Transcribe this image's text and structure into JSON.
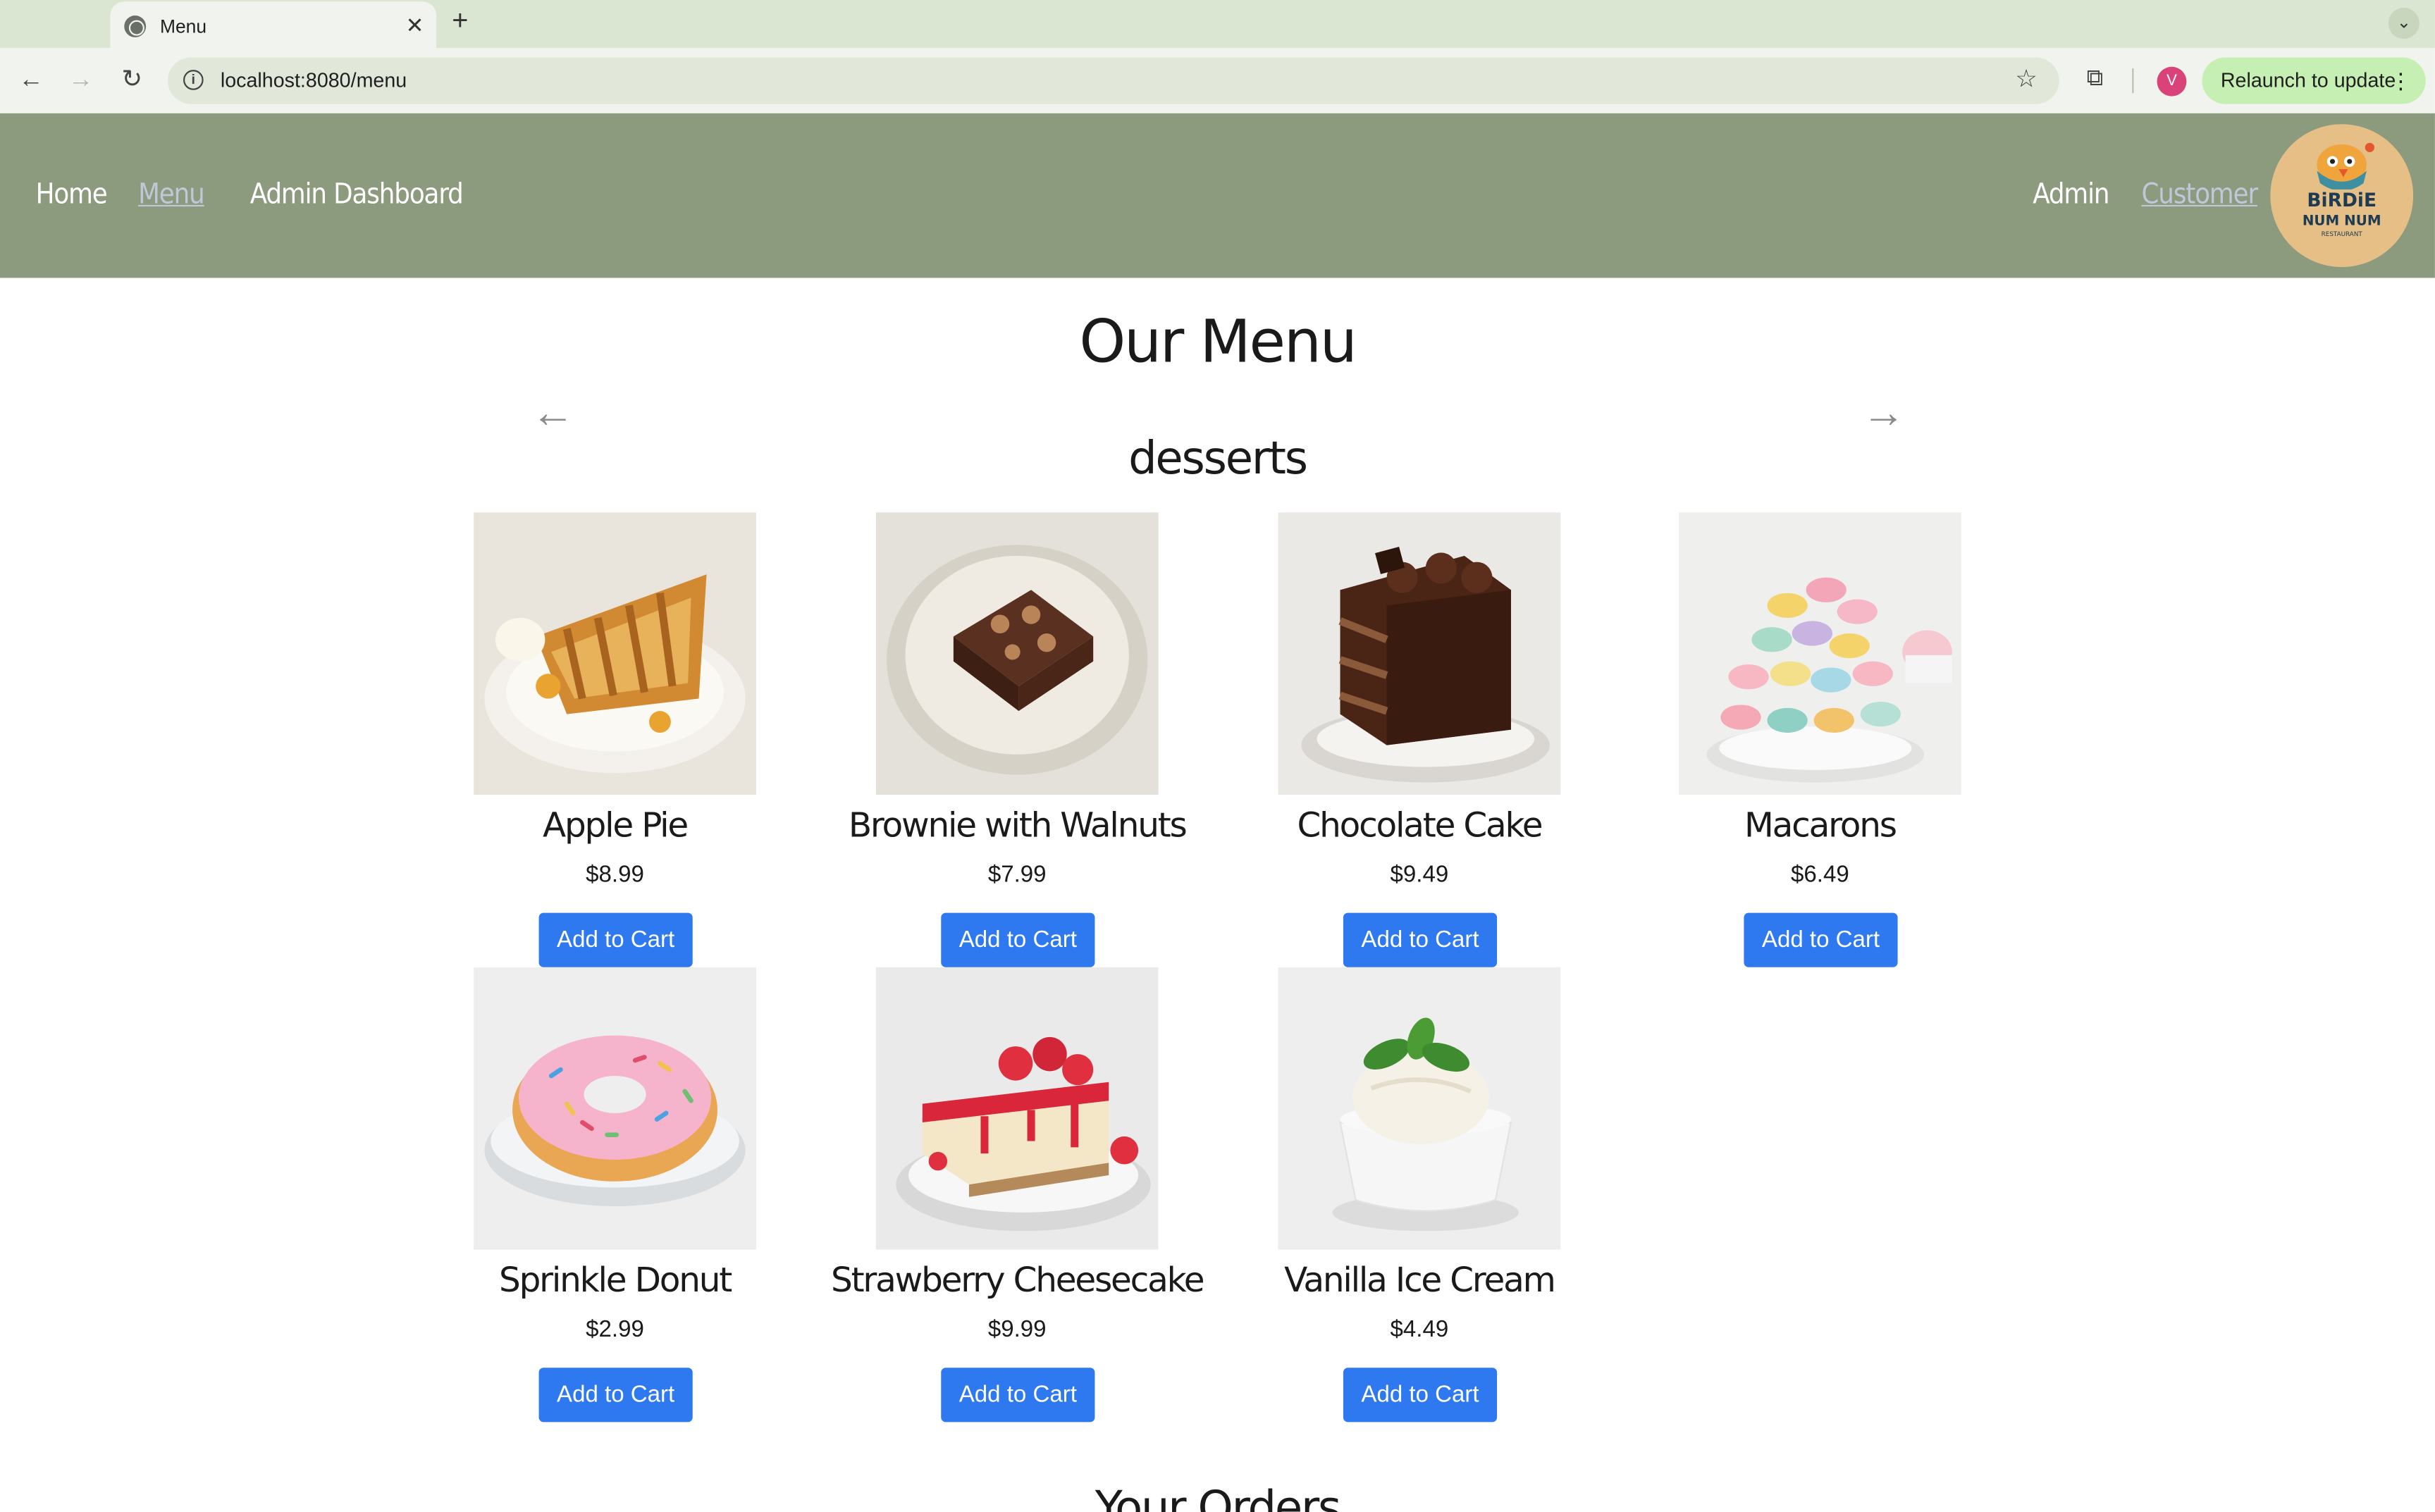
{
  "browser": {
    "tab_title": "Menu",
    "tab_close": "✕",
    "new_tab": "+",
    "tab_menu": "⌄",
    "url": "localhost:8080/menu",
    "profile_initial": "V",
    "relaunch_label": "Relaunch to update",
    "icons": [
      "globe-icon",
      "back-icon",
      "forward-icon",
      "reload-icon",
      "info-icon",
      "star-icon",
      "extensions-icon",
      "more-icon"
    ]
  },
  "nav": {
    "left": [
      {
        "label": "Home",
        "active": false
      },
      {
        "label": "Menu",
        "active": true
      },
      {
        "label": "Admin Dashboard",
        "active": false
      }
    ],
    "right": [
      {
        "label": "Admin",
        "active": false
      },
      {
        "label": "Customer",
        "active": true
      }
    ],
    "logo_text_1": "BiRDiE",
    "logo_text_2": "NUM NUM",
    "logo_text_3": "RESTAURANT"
  },
  "page": {
    "title": "Our Menu",
    "category": "desserts",
    "prev_arrow": "←",
    "next_arrow": "→",
    "orders_title": "Your Orders"
  },
  "items": [
    {
      "name": "Apple Pie",
      "price": "$8.99",
      "button": "Add to Cart",
      "image": "apple-pie"
    },
    {
      "name": "Brownie with Walnuts",
      "price": "$7.99",
      "button": "Add to Cart",
      "image": "brownie"
    },
    {
      "name": "Chocolate Cake",
      "price": "$9.49",
      "button": "Add to Cart",
      "image": "chocolate-cake"
    },
    {
      "name": "Macarons",
      "price": "$6.49",
      "button": "Add to Cart",
      "image": "macarons"
    },
    {
      "name": "Sprinkle Donut",
      "price": "$2.99",
      "button": "Add to Cart",
      "image": "donut"
    },
    {
      "name": "Strawberry Cheesecake",
      "price": "$9.99",
      "button": "Add to Cart",
      "image": "cheesecake"
    },
    {
      "name": "Vanilla Ice Cream",
      "price": "$4.49",
      "button": "Add to Cart",
      "image": "ice-cream"
    }
  ],
  "colors": {
    "nav_bg": "#8c9a7e",
    "button_bg": "#2f79f0",
    "active_link": "#bfc7d8",
    "logo_bg": "#e5bf86"
  }
}
